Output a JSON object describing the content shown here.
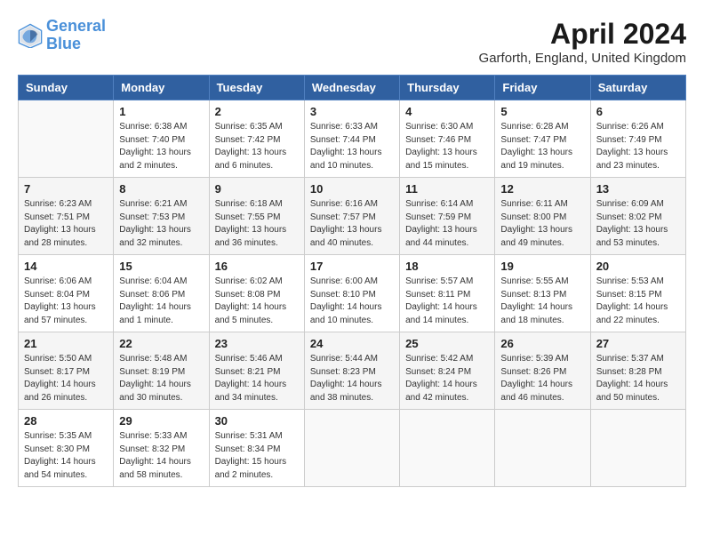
{
  "header": {
    "logo_line1": "General",
    "logo_line2": "Blue",
    "month_year": "April 2024",
    "location": "Garforth, England, United Kingdom"
  },
  "days_of_week": [
    "Sunday",
    "Monday",
    "Tuesday",
    "Wednesday",
    "Thursday",
    "Friday",
    "Saturday"
  ],
  "weeks": [
    [
      {
        "day": "",
        "info": ""
      },
      {
        "day": "1",
        "info": "Sunrise: 6:38 AM\nSunset: 7:40 PM\nDaylight: 13 hours\nand 2 minutes."
      },
      {
        "day": "2",
        "info": "Sunrise: 6:35 AM\nSunset: 7:42 PM\nDaylight: 13 hours\nand 6 minutes."
      },
      {
        "day": "3",
        "info": "Sunrise: 6:33 AM\nSunset: 7:44 PM\nDaylight: 13 hours\nand 10 minutes."
      },
      {
        "day": "4",
        "info": "Sunrise: 6:30 AM\nSunset: 7:46 PM\nDaylight: 13 hours\nand 15 minutes."
      },
      {
        "day": "5",
        "info": "Sunrise: 6:28 AM\nSunset: 7:47 PM\nDaylight: 13 hours\nand 19 minutes."
      },
      {
        "day": "6",
        "info": "Sunrise: 6:26 AM\nSunset: 7:49 PM\nDaylight: 13 hours\nand 23 minutes."
      }
    ],
    [
      {
        "day": "7",
        "info": "Sunrise: 6:23 AM\nSunset: 7:51 PM\nDaylight: 13 hours\nand 28 minutes."
      },
      {
        "day": "8",
        "info": "Sunrise: 6:21 AM\nSunset: 7:53 PM\nDaylight: 13 hours\nand 32 minutes."
      },
      {
        "day": "9",
        "info": "Sunrise: 6:18 AM\nSunset: 7:55 PM\nDaylight: 13 hours\nand 36 minutes."
      },
      {
        "day": "10",
        "info": "Sunrise: 6:16 AM\nSunset: 7:57 PM\nDaylight: 13 hours\nand 40 minutes."
      },
      {
        "day": "11",
        "info": "Sunrise: 6:14 AM\nSunset: 7:59 PM\nDaylight: 13 hours\nand 44 minutes."
      },
      {
        "day": "12",
        "info": "Sunrise: 6:11 AM\nSunset: 8:00 PM\nDaylight: 13 hours\nand 49 minutes."
      },
      {
        "day": "13",
        "info": "Sunrise: 6:09 AM\nSunset: 8:02 PM\nDaylight: 13 hours\nand 53 minutes."
      }
    ],
    [
      {
        "day": "14",
        "info": "Sunrise: 6:06 AM\nSunset: 8:04 PM\nDaylight: 13 hours\nand 57 minutes."
      },
      {
        "day": "15",
        "info": "Sunrise: 6:04 AM\nSunset: 8:06 PM\nDaylight: 14 hours\nand 1 minute."
      },
      {
        "day": "16",
        "info": "Sunrise: 6:02 AM\nSunset: 8:08 PM\nDaylight: 14 hours\nand 5 minutes."
      },
      {
        "day": "17",
        "info": "Sunrise: 6:00 AM\nSunset: 8:10 PM\nDaylight: 14 hours\nand 10 minutes."
      },
      {
        "day": "18",
        "info": "Sunrise: 5:57 AM\nSunset: 8:11 PM\nDaylight: 14 hours\nand 14 minutes."
      },
      {
        "day": "19",
        "info": "Sunrise: 5:55 AM\nSunset: 8:13 PM\nDaylight: 14 hours\nand 18 minutes."
      },
      {
        "day": "20",
        "info": "Sunrise: 5:53 AM\nSunset: 8:15 PM\nDaylight: 14 hours\nand 22 minutes."
      }
    ],
    [
      {
        "day": "21",
        "info": "Sunrise: 5:50 AM\nSunset: 8:17 PM\nDaylight: 14 hours\nand 26 minutes."
      },
      {
        "day": "22",
        "info": "Sunrise: 5:48 AM\nSunset: 8:19 PM\nDaylight: 14 hours\nand 30 minutes."
      },
      {
        "day": "23",
        "info": "Sunrise: 5:46 AM\nSunset: 8:21 PM\nDaylight: 14 hours\nand 34 minutes."
      },
      {
        "day": "24",
        "info": "Sunrise: 5:44 AM\nSunset: 8:23 PM\nDaylight: 14 hours\nand 38 minutes."
      },
      {
        "day": "25",
        "info": "Sunrise: 5:42 AM\nSunset: 8:24 PM\nDaylight: 14 hours\nand 42 minutes."
      },
      {
        "day": "26",
        "info": "Sunrise: 5:39 AM\nSunset: 8:26 PM\nDaylight: 14 hours\nand 46 minutes."
      },
      {
        "day": "27",
        "info": "Sunrise: 5:37 AM\nSunset: 8:28 PM\nDaylight: 14 hours\nand 50 minutes."
      }
    ],
    [
      {
        "day": "28",
        "info": "Sunrise: 5:35 AM\nSunset: 8:30 PM\nDaylight: 14 hours\nand 54 minutes."
      },
      {
        "day": "29",
        "info": "Sunrise: 5:33 AM\nSunset: 8:32 PM\nDaylight: 14 hours\nand 58 minutes."
      },
      {
        "day": "30",
        "info": "Sunrise: 5:31 AM\nSunset: 8:34 PM\nDaylight: 15 hours\nand 2 minutes."
      },
      {
        "day": "",
        "info": ""
      },
      {
        "day": "",
        "info": ""
      },
      {
        "day": "",
        "info": ""
      },
      {
        "day": "",
        "info": ""
      }
    ]
  ]
}
